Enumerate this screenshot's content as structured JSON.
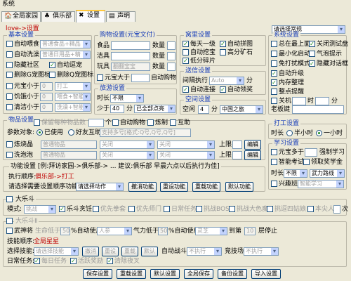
{
  "window": {
    "title": "系统"
  },
  "tabs": [
    "全局家园",
    "俱乐部",
    "设置",
    "声明"
  ],
  "status_line": "love->设置",
  "top_select": "请选择常规",
  "basic": {
    "title": "基本设置",
    "auto_food": "自动喂食",
    "auto_food_select": "普通食品+精品",
    "auto_wash": "自动洗澡",
    "auto_wash_select": "普通日用品+精",
    "hide_community": "隐藏社区",
    "auto_checkin": "自动逗宠",
    "delete_s_icon": "删除G宠图标",
    "delete_q_icon": "删除Q宠图标",
    "yuanbao_below": "元宝小于",
    "yuanbao_val": "0",
    "yuanbao_action": "打工",
    "hunger_below": "饥饿小于",
    "hunger_val": "0",
    "hunger_action": "喂食+智能",
    "clean_below": "清洁小于",
    "clean_val": "0",
    "clean_action": "洗澡+智能"
  },
  "shop": {
    "title": "购物设置(元宝文付)",
    "food": "食品",
    "toys": "洁具",
    "play": "玩具",
    "play_value": "翻翻宝宝",
    "qty": "数量",
    "yuanbao_more": "元宝大于",
    "auto_buy": "自动购物"
  },
  "travel": {
    "title": "旅游设置",
    "time_label": "时长",
    "time_value": "不限",
    "less_label": "少于",
    "less_value": "40",
    "unit": "分",
    "mode_value": "已全部点亮"
  },
  "lair": {
    "title": "窝里设置",
    "items": [
      {
        "label": "每天一级",
        "checked": true
      },
      {
        "label": "自动拼图",
        "checked": true
      },
      {
        "label": "自动挖宝",
        "checked": false
      },
      {
        "label": "高分矿石",
        "checked": false
      },
      {
        "label": "低分碎片",
        "checked": true
      }
    ]
  },
  "delivery": {
    "title": "送信设置",
    "interval_label": "间隔执行",
    "interval_value": "Auto",
    "interval_unit": "分",
    "items": [
      {
        "label": "自动连接",
        "checked": true
      },
      {
        "label": "自动领奖",
        "checked": true
      }
    ]
  },
  "space": {
    "title": "空间设置",
    "time_label": "空闲",
    "time_value": "4",
    "unit": "分",
    "place": "中国之旅"
  },
  "system": {
    "title": "系统设置",
    "items": [
      {
        "label": "总在最上面",
        "checked": false
      },
      {
        "label": "关闭测试盘",
        "checked": true
      },
      {
        "label": "最小化启动",
        "checked": false
      },
      {
        "label": "气泡提示",
        "checked": false
      },
      {
        "label": "免打扰模式",
        "checked": false
      },
      {
        "label": "隐藏对话框",
        "checked": true
      },
      {
        "label": "自动升级",
        "checked": true
      },
      {
        "label": "内存整理",
        "checked": true
      },
      {
        "label": "整点提醒",
        "checked": false
      }
    ],
    "shutdown": "关机",
    "hour": "时",
    "minute": "分",
    "boss_key": "老板键"
  },
  "items": {
    "title": "物品设置",
    "keep_item": "保留每种物品数",
    "keep_count": "个",
    "auto_buy": "自动购物",
    "forge": "炼制",
    "interact": "互助",
    "target_label": "参数对象:",
    "radio_self": "已使用",
    "radio_friend": "好友互助",
    "target_placeholder": "支持多号[格式:Q号,Q号,Q号]",
    "refine": "炼烧晶",
    "refine_items": "普通物品",
    "mix": "洗泡泡",
    "mix_items": "普通物品",
    "off": "关闭",
    "upper": "上限",
    "edit": "编辑"
  },
  "club": {
    "title": "功能设置 [例:拜访家园->俱乐部-> ... 建议:俱乐部 早晨六点以后执行为佳]",
    "order_label": "执行顺序:",
    "order_value": "俱乐部->打工",
    "pick_label": "请选择需要设置顺序功能:",
    "pick_value": "请选择动作",
    "buttons": [
      "撤消功能",
      "重设功能",
      "重载功能",
      "默认功能"
    ]
  },
  "work": {
    "title": "打工设置",
    "time_label": "时长",
    "half": "半小时",
    "one": "一小时"
  },
  "study": {
    "title": "学习设置",
    "yuanbao_more": "元宝多于",
    "force": "强制学习",
    "smart_study": "智能考试",
    "claim": "领取奖学金",
    "time_label": "时长",
    "time_value": "不限",
    "course_value": "武力路线",
    "interest": "兴趣班",
    "interest_value": "智能学习"
  },
  "fight": {
    "title": "大乐斗",
    "mode_label": "模式:",
    "mode_value": "挑战",
    "fight_check": "乐斗烹饪",
    "opts": [
      "优先拳套",
      "优先师门",
      "日常任务",
      "挑战BOSS",
      "挑战大色魔",
      "挑逗四姑娘",
      "本尖人",
      "次"
    ]
  },
  "fight2": {
    "title": "大乐斗Ⅱ",
    "armor": "武神将",
    "life_less": "生命低于",
    "life_pct": "50",
    "auto_use": "%自动使用",
    "pill": "人参",
    "qi_less": "气力低于",
    "qi_pct": "50",
    "auto_use2": "%自动使用",
    "item2": "灵芝",
    "to": "到第",
    "floor": "10",
    "stop": "层停止",
    "skill_label": "技能顺序:",
    "skill_value": "全局星星",
    "pick_label": "选择技能:",
    "pick_value": "请选择技能",
    "buttons": [
      "撤消",
      "重设",
      "重载",
      "默认"
    ],
    "auto_fight": "自动战斗",
    "auto_fight_value": "不执行",
    "arena": "竞技场",
    "arena_value": "不执行",
    "daily_label": "日常任务:",
    "daily": [
      "每日任务",
      "活跃奖励",
      "清除夜叉"
    ]
  },
  "bottom": [
    "保存设置",
    "重载设置",
    "默认设置",
    "全局保存",
    "备份设置",
    "导入设置"
  ]
}
